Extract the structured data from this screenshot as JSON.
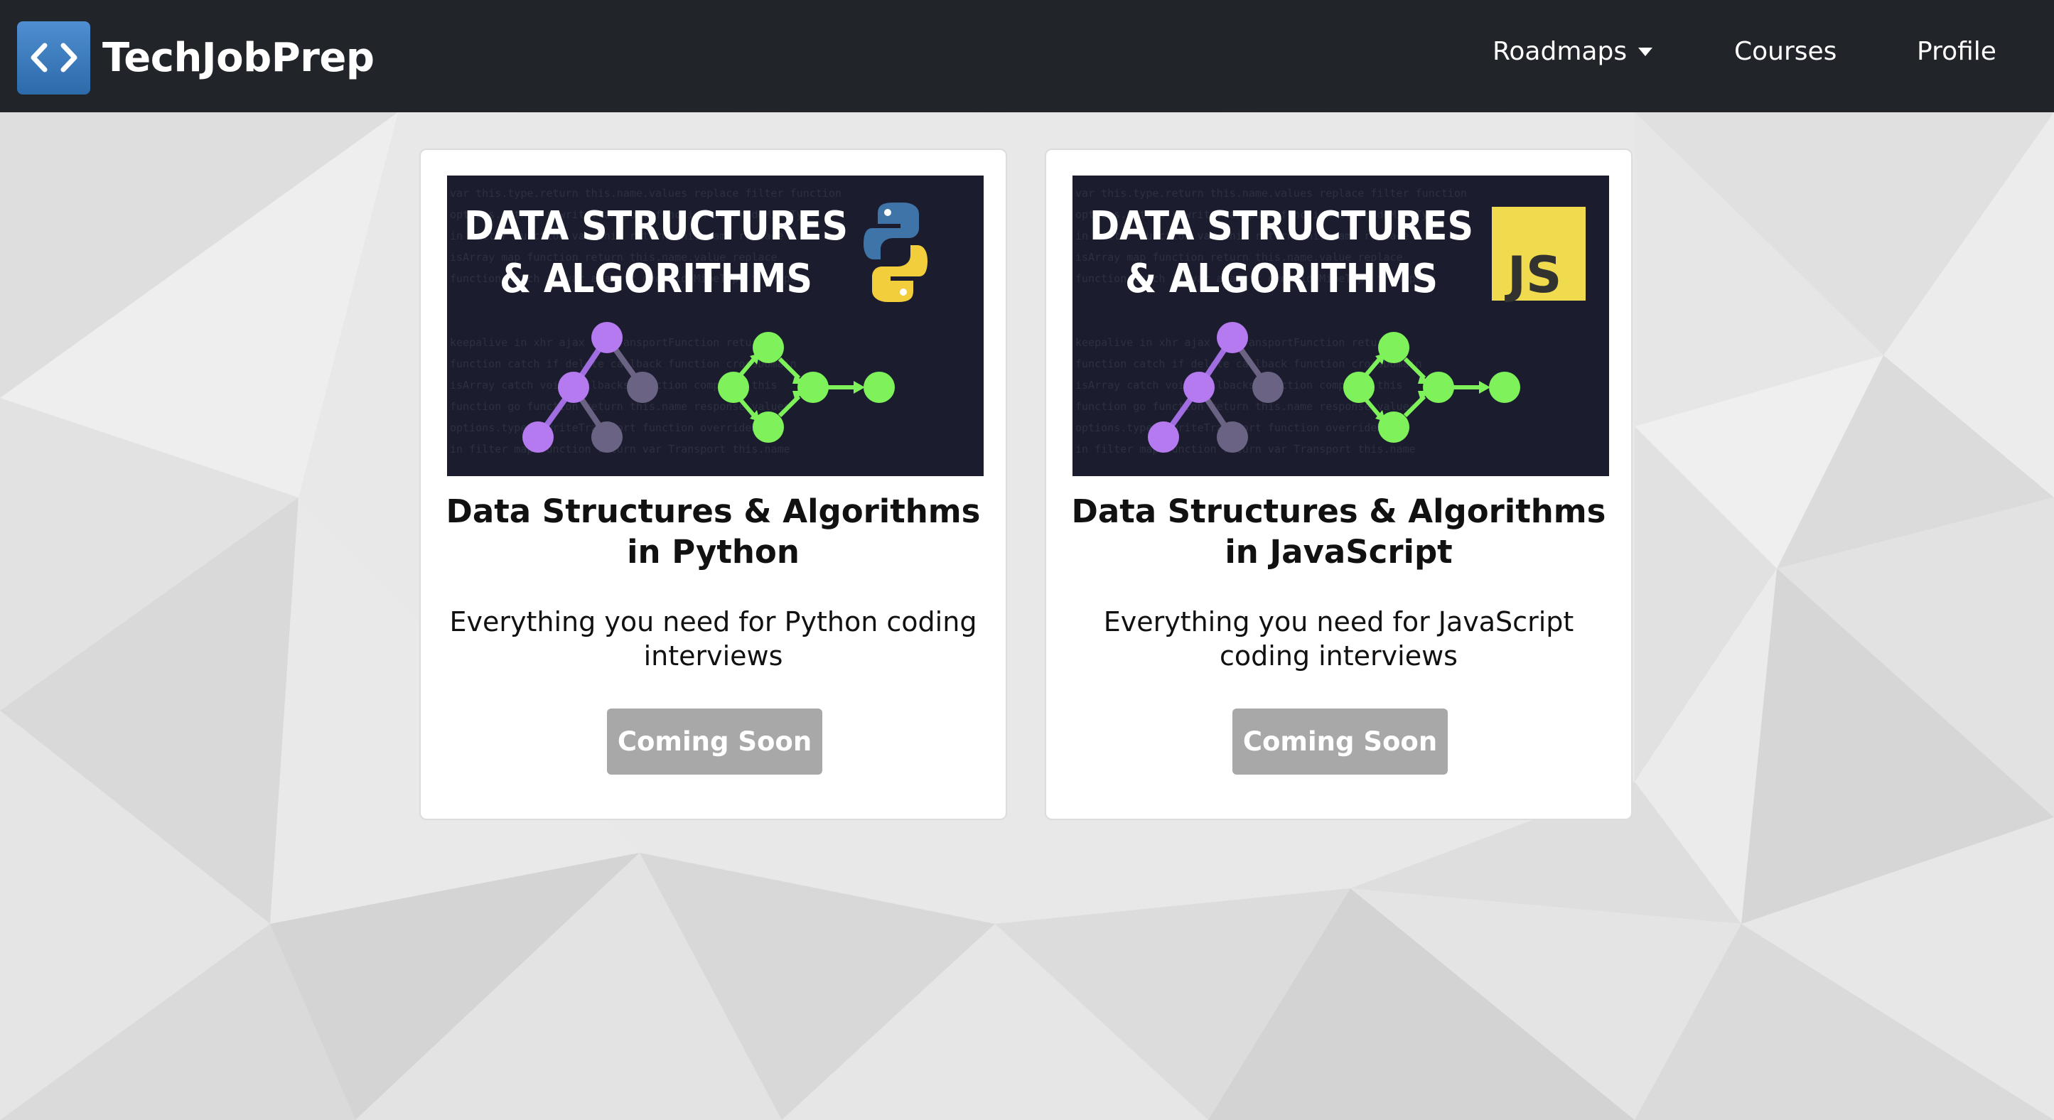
{
  "navbar": {
    "brand_name": "TechJobPrep",
    "logo_icon": "code-brackets-icon",
    "items": [
      {
        "label": "Roadmaps",
        "has_dropdown": true
      },
      {
        "label": "Courses"
      },
      {
        "label": "Profile"
      }
    ]
  },
  "courses": [
    {
      "image_title_line1": "DATA STRUCTURES",
      "image_title_line2": "& ALGORITHMS",
      "image_badge": "python-logo",
      "title": "Data Structures & Algorithms in Python",
      "description": "Everything you need for Python coding interviews",
      "button_label": "Coming Soon"
    },
    {
      "image_title_line1": "DATA STRUCTURES",
      "image_title_line2": "& ALGORITHMS",
      "image_badge": "JS",
      "title": "Data Structures & Algorithms in JavaScript",
      "description": "Everything you need for JavaScript coding interviews",
      "button_label": "Coming Soon"
    }
  ],
  "colors": {
    "navbar_bg": "#212429",
    "logo_blue": "#3b7cc0",
    "button_disabled": "#a8a8a8",
    "tree_purple": "#b57af0",
    "graph_green": "#7ff25b",
    "js_yellow": "#f0db4f"
  }
}
